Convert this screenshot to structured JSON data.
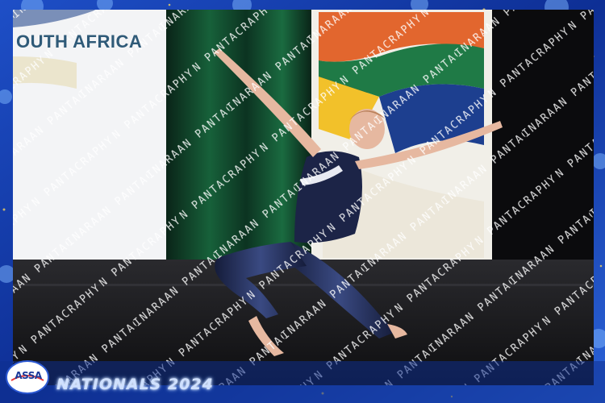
{
  "banner": {
    "text": "OUTH AFRICA"
  },
  "footer": {
    "event": "NATIONALS 2024",
    "logo": "ASSA"
  },
  "watermark": {
    "text": "INARAAN PANTACRAPHY"
  },
  "colors": {
    "frame": "#123a9c",
    "stage_floor": "#1a1a1d",
    "curtain": "#0f3b25",
    "costume": "#1c2447"
  }
}
